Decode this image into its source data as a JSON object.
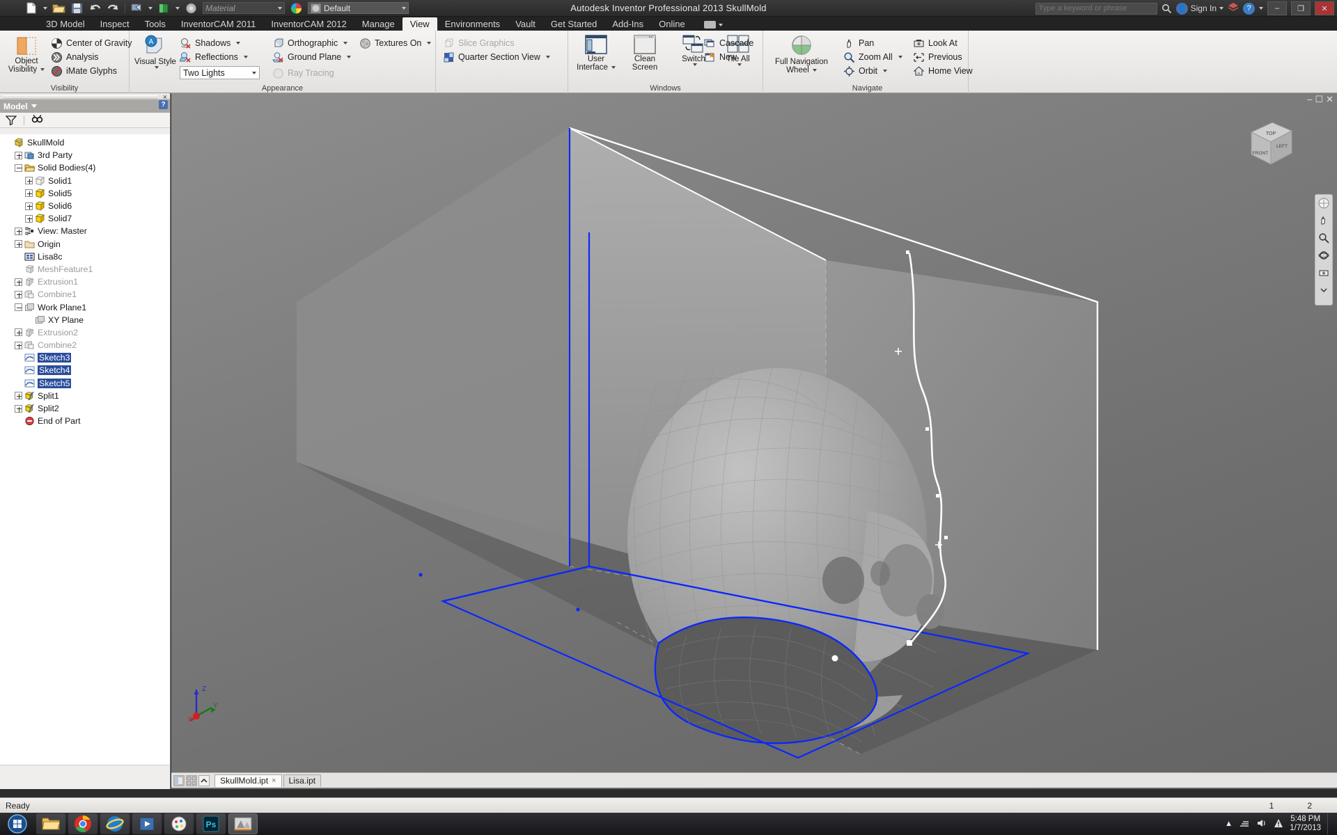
{
  "titlebar": {
    "title": "Autodesk Inventor Professional 2013     SkullMold",
    "material_value": "Material",
    "appearance_value": "Default",
    "search_placeholder": "Type a keyword or phrase",
    "signin_label": "Sign In",
    "help_label": "?",
    "min_label": "–",
    "max_label": "❐",
    "close_label": "✕"
  },
  "tabs": [
    {
      "label": "3D Model",
      "active": false
    },
    {
      "label": "Inspect",
      "active": false
    },
    {
      "label": "Tools",
      "active": false
    },
    {
      "label": "InventorCAM 2011",
      "active": false
    },
    {
      "label": "InventorCAM 2012",
      "active": false
    },
    {
      "label": "Manage",
      "active": false
    },
    {
      "label": "View",
      "active": true
    },
    {
      "label": "Environments",
      "active": false
    },
    {
      "label": "Vault",
      "active": false
    },
    {
      "label": "Get Started",
      "active": false
    },
    {
      "label": "Add-Ins",
      "active": false
    },
    {
      "label": "Online",
      "active": false
    }
  ],
  "ribbon": {
    "panels": [
      {
        "name": "Visibility",
        "label": "Visibility",
        "big": {
          "line1": "Object",
          "line2": "Visibility"
        },
        "items": [
          {
            "label": "Center of Gravity",
            "icon": "center-of-gravity-icon",
            "disabled": false,
            "dropdown": false
          },
          {
            "label": "Analysis",
            "icon": "analysis-icon",
            "disabled": false,
            "dropdown": false
          },
          {
            "label": "iMate Glyphs",
            "icon": "imate-glyphs-icon",
            "disabled": false,
            "dropdown": false
          }
        ]
      },
      {
        "name": "Appearance",
        "label": "Appearance",
        "big": {
          "line1": "Visual Style",
          "line2": ""
        },
        "items": [
          {
            "label": "Shadows",
            "icon": "shadows-icon",
            "disabled": false,
            "dropdown": true
          },
          {
            "label": "Reflections",
            "icon": "reflections-icon",
            "disabled": false,
            "dropdown": true
          },
          {
            "label": "Orthographic",
            "icon": "orthographic-icon",
            "disabled": false,
            "dropdown": true
          },
          {
            "label": "Ground Plane",
            "icon": "ground-plane-icon",
            "disabled": false,
            "dropdown": true
          },
          {
            "label": "Ray Tracing",
            "icon": "ray-tracing-icon",
            "disabled": true,
            "dropdown": false
          },
          {
            "label": "Textures On",
            "icon": "textures-icon",
            "disabled": false,
            "dropdown": true
          }
        ],
        "lighting_style": "Two Lights"
      },
      {
        "name": "Scene",
        "label": "",
        "items": [
          {
            "label": "Slice Graphics",
            "icon": "slice-graphics-icon",
            "disabled": true,
            "dropdown": false
          },
          {
            "label": "Quarter Section View",
            "icon": "quarter-section-icon",
            "disabled": false,
            "dropdown": true
          }
        ]
      },
      {
        "name": "Windows",
        "label": "Windows",
        "buttons": [
          {
            "line1": "User",
            "line2": "Interface",
            "icon": "user-interface-icon",
            "dropdown": true
          },
          {
            "line1": "Clean",
            "line2": "Screen",
            "icon": "clean-screen-icon",
            "dropdown": false
          },
          {
            "line1": "Switch",
            "line2": "",
            "icon": "switch-windows-icon",
            "dropdown": true
          },
          {
            "line1": "Tile All",
            "line2": "",
            "icon": "tile-all-icon",
            "dropdown": true
          }
        ],
        "items": [
          {
            "label": "Cascade",
            "icon": "cascade-icon",
            "disabled": false,
            "dropdown": false
          },
          {
            "label": "New",
            "icon": "new-window-icon",
            "disabled": false,
            "dropdown": false
          }
        ]
      },
      {
        "name": "Navigate",
        "label": "Navigate",
        "big": {
          "line1": "Full Navigation",
          "line2": "Wheel"
        },
        "items": [
          {
            "label": "Pan",
            "icon": "pan-icon",
            "disabled": false,
            "dropdown": false
          },
          {
            "label": "Zoom All",
            "icon": "zoom-all-icon",
            "disabled": false,
            "dropdown": true
          },
          {
            "label": "Orbit",
            "icon": "orbit-icon",
            "disabled": false,
            "dropdown": true
          },
          {
            "label": "Look At",
            "icon": "look-at-icon",
            "disabled": false,
            "dropdown": false
          },
          {
            "label": "Previous",
            "icon": "previous-view-icon",
            "disabled": false,
            "dropdown": false
          },
          {
            "label": "Home View",
            "icon": "home-view-icon",
            "disabled": false,
            "dropdown": false
          }
        ]
      }
    ]
  },
  "browser": {
    "header": "Model",
    "filter_icon": "filter-icon",
    "find_icon": "find-icon",
    "close_icon": "close-icon",
    "help_icon": "help-icon",
    "tree": [
      {
        "label": "SkullMold",
        "depth": 0,
        "expander": "none",
        "icon": "part-icon",
        "dim": false,
        "selected": false
      },
      {
        "label": "3rd Party",
        "depth": 1,
        "expander": "plus",
        "icon": "thirdparty-icon",
        "dim": false,
        "selected": false
      },
      {
        "label": "Solid Bodies(4)",
        "depth": 1,
        "expander": "minus",
        "icon": "folder-icon",
        "dim": false,
        "selected": false
      },
      {
        "label": "Solid1",
        "depth": 2,
        "expander": "plus",
        "icon": "solid-grey-icon",
        "dim": false,
        "selected": false
      },
      {
        "label": "Solid5",
        "depth": 2,
        "expander": "plus",
        "icon": "solid-yellow-icon",
        "dim": false,
        "selected": false
      },
      {
        "label": "Solid6",
        "depth": 2,
        "expander": "plus",
        "icon": "solid-yellow-icon",
        "dim": false,
        "selected": false
      },
      {
        "label": "Solid7",
        "depth": 2,
        "expander": "plus",
        "icon": "solid-yellow-icon",
        "dim": false,
        "selected": false
      },
      {
        "label": "View: Master",
        "depth": 1,
        "expander": "plus",
        "icon": "view-icon",
        "dim": false,
        "selected": false
      },
      {
        "label": "Origin",
        "depth": 1,
        "expander": "plus",
        "icon": "folder-tan-icon",
        "dim": false,
        "selected": false
      },
      {
        "label": "Lisa8c",
        "depth": 1,
        "expander": "none",
        "icon": "mesh-blue-icon",
        "dim": false,
        "selected": false
      },
      {
        "label": "MeshFeature1",
        "depth": 1,
        "expander": "none",
        "icon": "feature-icon",
        "dim": true,
        "selected": false
      },
      {
        "label": "Extrusion1",
        "depth": 1,
        "expander": "plus",
        "icon": "extrusion-icon",
        "dim": true,
        "selected": false
      },
      {
        "label": "Combine1",
        "depth": 1,
        "expander": "plus",
        "icon": "combine-icon",
        "dim": true,
        "selected": false
      },
      {
        "label": "Work Plane1",
        "depth": 1,
        "expander": "minus",
        "icon": "workplane-icon",
        "dim": false,
        "selected": false
      },
      {
        "label": "XY Plane",
        "depth": 2,
        "expander": "none",
        "icon": "workplane-icon",
        "dim": false,
        "selected": false
      },
      {
        "label": "Extrusion2",
        "depth": 1,
        "expander": "plus",
        "icon": "extrusion-icon",
        "dim": true,
        "selected": false
      },
      {
        "label": "Combine2",
        "depth": 1,
        "expander": "plus",
        "icon": "combine-icon",
        "dim": true,
        "selected": false
      },
      {
        "label": "Sketch3",
        "depth": 1,
        "expander": "none",
        "icon": "sketch-icon",
        "dim": false,
        "selected": true
      },
      {
        "label": "Sketch4",
        "depth": 1,
        "expander": "none",
        "icon": "sketch-icon",
        "dim": false,
        "selected": true
      },
      {
        "label": "Sketch5",
        "depth": 1,
        "expander": "none",
        "icon": "sketch-icon",
        "dim": false,
        "selected": true
      },
      {
        "label": "Split1",
        "depth": 1,
        "expander": "plus",
        "icon": "split-icon",
        "dim": false,
        "selected": false
      },
      {
        "label": "Split2",
        "depth": 1,
        "expander": "plus",
        "icon": "split-icon",
        "dim": false,
        "selected": false
      },
      {
        "label": "End of Part",
        "depth": 1,
        "expander": "none",
        "icon": "end-of-part-icon",
        "dim": false,
        "selected": false
      }
    ]
  },
  "viewport": {
    "restore_icon": "restore-icon",
    "minimize_icon": "minimize-icon",
    "close_icon": "close-icon",
    "viewcube": {
      "top": "TOP",
      "front": "FRONT",
      "right": "LEFT"
    },
    "axis": {
      "x": "X",
      "y": "Y",
      "z": "Z"
    },
    "navbar_icons": [
      "full-navigation-wheel-icon",
      "pan-icon",
      "zoom-icon",
      "orbit-icon",
      "look-at-icon"
    ]
  },
  "docstrip": {
    "buttons": [
      "layout-icon",
      "grid-icon",
      "scroll-up-icon"
    ],
    "tabs": [
      {
        "label": "SkullMold.ipt",
        "active": true,
        "close": "×"
      },
      {
        "label": "Lisa.ipt",
        "active": false,
        "close": ""
      }
    ]
  },
  "statusbar": {
    "text": "Ready",
    "right_items": [
      "1",
      "2"
    ]
  },
  "taskbar": {
    "start_icon": "start-orb-icon",
    "apps": [
      {
        "icon": "explorer-icon"
      },
      {
        "icon": "chrome-icon"
      },
      {
        "icon": "internet-explorer-icon"
      },
      {
        "icon": "media-icon"
      },
      {
        "icon": "paint-icon"
      },
      {
        "icon": "photoshop-icon"
      },
      {
        "icon": "inventor-icon"
      }
    ],
    "tray_icons": [
      "show-desktop-icon",
      "network-icon",
      "volume-icon",
      "action-center-icon"
    ],
    "time": "5:48 PM",
    "date": "1/7/2013"
  },
  "colors": {
    "accent": "#2a4d9b",
    "sketch_blue": "#0a28ff",
    "yellow_solid": "#ffd400",
    "ribbon_bg": "#f0eeec"
  }
}
